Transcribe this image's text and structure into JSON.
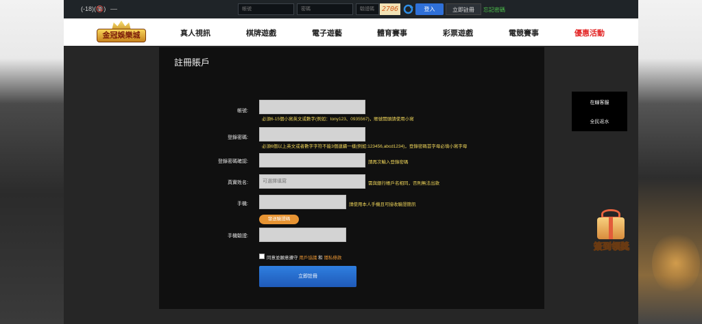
{
  "header": {
    "age_badge": "(-18)(🔞)",
    "username_placeholder": "帳號",
    "password_placeholder": "密碼",
    "captcha_placeholder": "驗證碼",
    "captcha_code": "2706",
    "login_label": "登入",
    "register_label": "立即註冊",
    "forgot_label": "忘記密碼"
  },
  "nav": {
    "logo_text": "金冠娛樂城",
    "items": [
      "真人視訊",
      "棋牌遊戲",
      "電子遊藝",
      "體育賽事",
      "彩票遊戲",
      "電競賽事",
      "優惠活動"
    ]
  },
  "form": {
    "title": "註冊賬戶",
    "account_label": "帳號:",
    "account_hint": "必須6-15個小寫英文或數字(例如：tony123、0935567)，賬號開頭請使用小寫",
    "password_label": "登錄密碼:",
    "password_hint": "必須6個以上英文或者數字字符不能3個連續一樣(例如:123456,abcd1234)，登錄密碼首字母必填小寫字母",
    "confirm_label": "登錄密碼確認:",
    "confirm_hint": "請再次輸入登錄密碼",
    "realname_label": "真實姓名:",
    "realname_placeholder": "可選擇填寫",
    "realname_hint": "需與銀行帳戶名相同，否則無法出款",
    "phone_label": "手機:",
    "phone_hint": "請使用本人手機且可接收驗證簡訊",
    "get_code_label": "發送驗證碼",
    "verify_label": "手機驗證:",
    "agree_prefix": "同意並願意遵守",
    "agree_terms": "用戶協議",
    "agree_and": "和",
    "agree_privacy": "隱私條款",
    "submit_label": "立即註冊"
  },
  "service": {
    "title": "在線客服",
    "item": "全民返水"
  },
  "promo_widget": {
    "label": "簽到領獎"
  },
  "colors": {
    "accent_blue": "#2f70d8",
    "hint_yellow": "#f0d65a",
    "orange": "#e79433",
    "promo_red": "#e32626"
  }
}
